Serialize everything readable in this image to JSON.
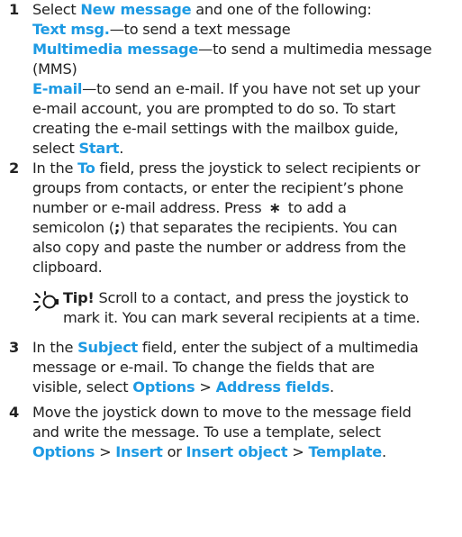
{
  "steps": [
    {
      "number": "1",
      "intro_pre": "Select ",
      "new_message": "New message",
      "intro_post": " and one of the following:",
      "options": [
        {
          "name": "Text msg.",
          "desc": "—to send a text message"
        },
        {
          "name": "Multimedia message",
          "desc": "—to send a multimedia message",
          "desc2": "(MMS)"
        },
        {
          "name": "E-mail",
          "desc": "—to send an e-mail. If you have not set up your",
          "lines": [
            "e-mail account, you are prompted to do so. To start",
            "creating the e-mail settings with the mailbox guide,"
          ],
          "select_pre": "select ",
          "start": "Start",
          "select_post": "."
        }
      ]
    },
    {
      "number": "2",
      "l1_pre": "In the ",
      "to": "To",
      "l1_post": " field, press the joystick to select recipients or",
      "l2": "groups from contacts, or enter the recipient’s phone",
      "l3_pre": "number or e-mail address. Press",
      "star": "∗",
      "l3_post": "to add a",
      "l4_pre": "semicolon (",
      "semicolon": ";",
      "l4_post": ") that separates the recipients. You can",
      "l5": "also copy and paste the number or address from the",
      "l6": "clipboard."
    },
    {
      "tip_label": "Tip!",
      "tip_l1": " Scroll to a contact, and press the joystick to",
      "tip_l2": "mark it. You can mark several recipients at a time."
    },
    {
      "number": "3",
      "l1_pre": "In the ",
      "subject": "Subject",
      "l1_post": " field, enter the subject of a multimedia",
      "l2": "message or e-mail. To change the fields that are",
      "l3_pre": "visible, select ",
      "options": "Options",
      "sep": " > ",
      "address_fields": "Address fields",
      "l3_post": "."
    },
    {
      "number": "4",
      "l1": "Move the joystick down to move to the message field",
      "l2_pre": "and write the message. To use a template, select",
      "options": "Options",
      "sep1": " > ",
      "insert": "Insert",
      "or": " or ",
      "insert_object": "Insert object",
      "sep2": " > ",
      "template": "Template",
      "end": "."
    }
  ],
  "colors": {
    "highlight": "#1d9ae3",
    "text": "#222222",
    "tip_icon": "#1a1a1a"
  },
  "icons": {
    "tip": "lightbulb-icon"
  }
}
